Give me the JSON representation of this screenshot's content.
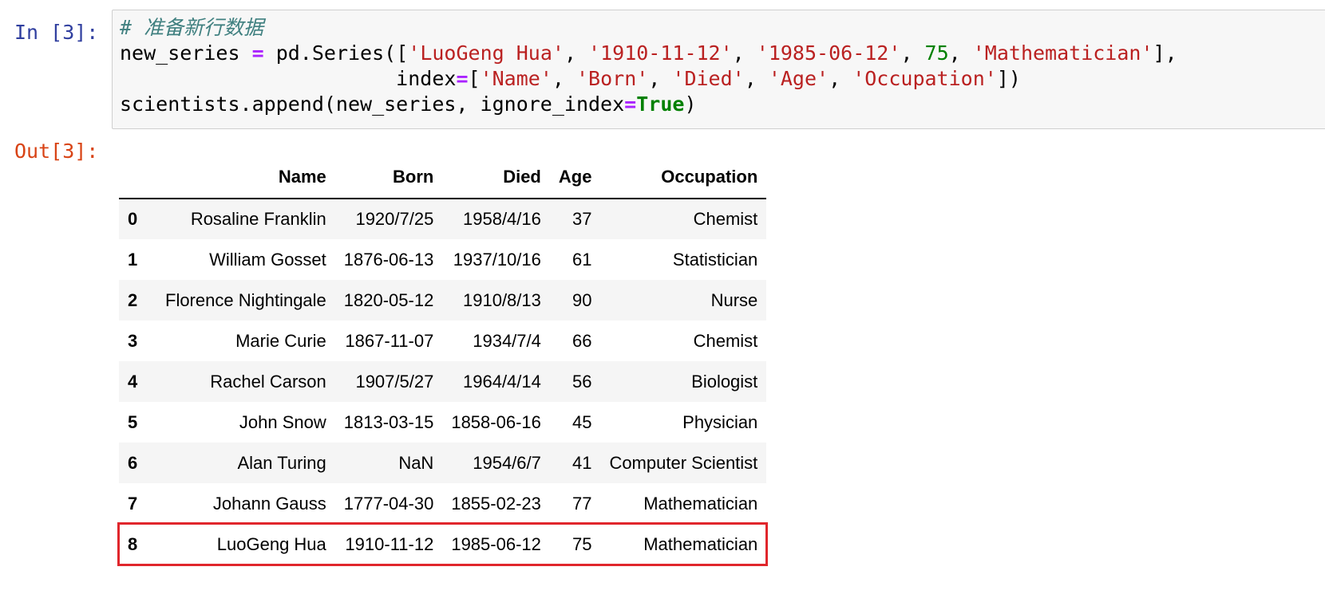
{
  "prompts": {
    "in": "In [3]:",
    "out": "Out[3]:"
  },
  "code": {
    "comment": "# 准备新行数据",
    "l2_a": "new_series ",
    "l2_eq": "=",
    "l2_b": " pd.Series([",
    "s_luogeng": "'LuoGeng Hua'",
    "comma1": ", ",
    "s_born": "'1910-11-12'",
    "comma2": ", ",
    "s_died": "'1985-06-12'",
    "comma3": ", ",
    "n_age": "75",
    "comma4": ", ",
    "s_occ": "'Mathematician'",
    "l2_end": "],",
    "l3_indent": "                       index",
    "l3_eq": "=",
    "l3_open": "[",
    "s_name": "'Name'",
    "c5": ", ",
    "s_bornk": "'Born'",
    "c6": ", ",
    "s_diedk": "'Died'",
    "c7": ", ",
    "s_agek": "'Age'",
    "c8": ", ",
    "s_occk": "'Occupation'",
    "l3_end": "])",
    "l4_a": "scientists.append(new_series, ignore_index",
    "l4_eq": "=",
    "l4_kw": "True",
    "l4_end": ")"
  },
  "dataframe": {
    "columns": [
      "",
      "Name",
      "Born",
      "Died",
      "Age",
      "Occupation"
    ],
    "rows": [
      {
        "idx": "0",
        "name": "Rosaline Franklin",
        "born": "1920/7/25",
        "died": "1958/4/16",
        "age": "37",
        "occupation": "Chemist"
      },
      {
        "idx": "1",
        "name": "William Gosset",
        "born": "1876-06-13",
        "died": "1937/10/16",
        "age": "61",
        "occupation": "Statistician"
      },
      {
        "idx": "2",
        "name": "Florence Nightingale",
        "born": "1820-05-12",
        "died": "1910/8/13",
        "age": "90",
        "occupation": "Nurse"
      },
      {
        "idx": "3",
        "name": "Marie Curie",
        "born": "1867-11-07",
        "died": "1934/7/4",
        "age": "66",
        "occupation": "Chemist"
      },
      {
        "idx": "4",
        "name": "Rachel Carson",
        "born": "1907/5/27",
        "died": "1964/4/14",
        "age": "56",
        "occupation": "Biologist"
      },
      {
        "idx": "5",
        "name": "John Snow",
        "born": "1813-03-15",
        "died": "1858-06-16",
        "age": "45",
        "occupation": "Physician"
      },
      {
        "idx": "6",
        "name": "Alan Turing",
        "born": "NaN",
        "died": "1954/6/7",
        "age": "41",
        "occupation": "Computer Scientist"
      },
      {
        "idx": "7",
        "name": "Johann Gauss",
        "born": "1777-04-30",
        "died": "1855-02-23",
        "age": "77",
        "occupation": "Mathematician"
      },
      {
        "idx": "8",
        "name": "LuoGeng Hua",
        "born": "1910-11-12",
        "died": "1985-06-12",
        "age": "75",
        "occupation": "Mathematician"
      }
    ],
    "highlight_row": "8",
    "highlight_color": "#e0262c"
  }
}
